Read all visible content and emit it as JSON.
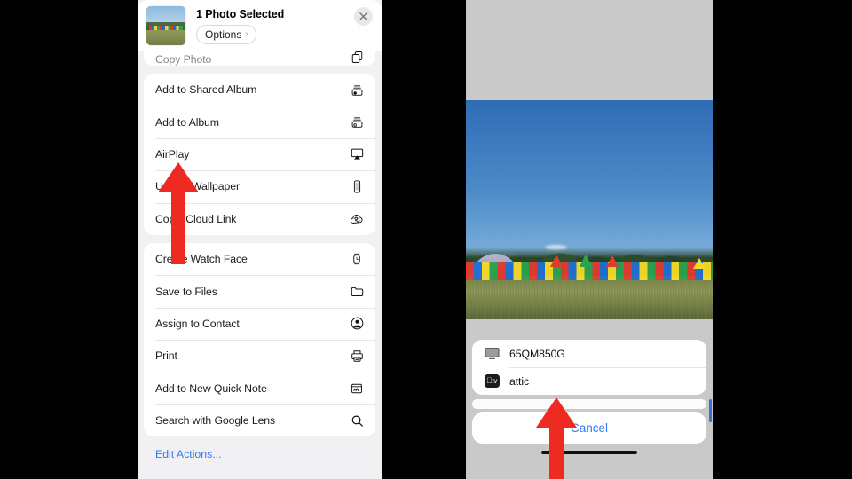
{
  "share_sheet": {
    "title": "1 Photo Selected",
    "options_label": "Options",
    "options_chevron": "›",
    "close_icon": "close-icon",
    "thumbnail_icon": "photo-thumbnail",
    "groups": [
      {
        "items": [
          {
            "label": "Copy Photo",
            "icon": "copy-icon",
            "clipped": true
          }
        ]
      },
      {
        "items": [
          {
            "label": "Add to Shared Album",
            "icon": "shared-album-icon"
          },
          {
            "label": "Add to Album",
            "icon": "add-album-icon"
          },
          {
            "label": "AirPlay",
            "icon": "airplay-icon"
          },
          {
            "label": "Use as Wallpaper",
            "icon": "wallpaper-icon"
          },
          {
            "label": "Copy iCloud Link",
            "icon": "icloud-link-icon"
          }
        ]
      },
      {
        "items": [
          {
            "label": "Create Watch Face",
            "icon": "watch-icon"
          },
          {
            "label": "Save to Files",
            "icon": "folder-icon"
          },
          {
            "label": "Assign to Contact",
            "icon": "contact-icon"
          },
          {
            "label": "Print",
            "icon": "printer-icon"
          },
          {
            "label": "Add to New Quick Note",
            "icon": "quick-note-icon"
          },
          {
            "label": "Search with Google Lens",
            "icon": "search-icon"
          }
        ]
      }
    ],
    "edit_actions_label": "Edit Actions..."
  },
  "airplay_picker": {
    "devices": [
      {
        "name": "65QM850G",
        "icon": "tv-icon"
      },
      {
        "name": "attic",
        "icon": "apple-tv-icon"
      }
    ],
    "apple_tv_glyph": "tv",
    "cancel_label": "Cancel"
  },
  "annotations": {
    "arrow_color": "#ed2b23",
    "arrows": [
      {
        "name": "arrow-pointing-to-airplay",
        "target": "AirPlay"
      },
      {
        "name": "arrow-pointing-to-device-65qm850g",
        "target": "65QM850G"
      }
    ]
  },
  "colors": {
    "accent_blue": "#3478f6",
    "sheet_background": "#f1f1f3",
    "card_white": "#ffffff",
    "phone_background": "#c9c9c9",
    "letterbox_black": "#000000"
  }
}
